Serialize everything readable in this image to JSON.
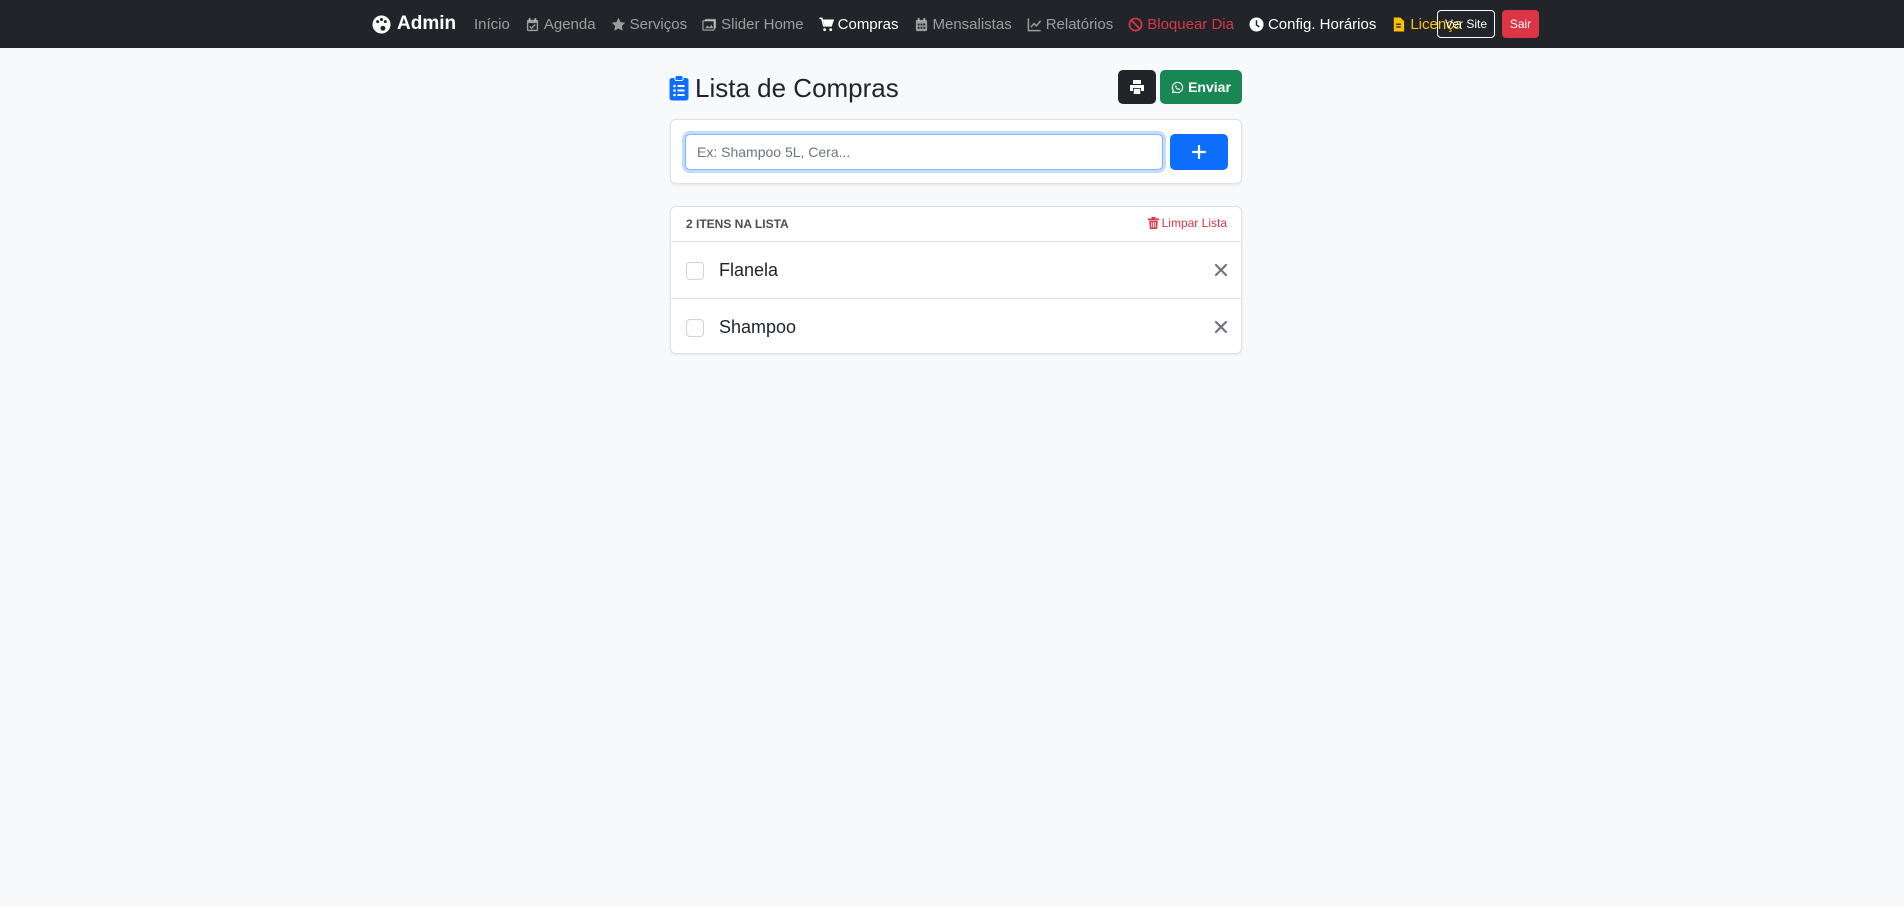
{
  "navbar": {
    "brand": "Admin",
    "items": [
      {
        "label": "Início",
        "icon": "none"
      },
      {
        "label": "Agenda",
        "icon": "calendar-check-icon"
      },
      {
        "label": "Serviços",
        "icon": "star-icon"
      },
      {
        "label": "Slider Home",
        "icon": "images-icon"
      },
      {
        "label": "Compras",
        "icon": "cart-icon"
      },
      {
        "label": "Mensalistas",
        "icon": "calendar-icon"
      },
      {
        "label": "Relatórios",
        "icon": "chart-line-icon"
      },
      {
        "label": "Bloquear Dia",
        "icon": "ban-icon"
      },
      {
        "label": "Config. Horários",
        "icon": "clock-icon"
      },
      {
        "label": "Licença",
        "icon": "file-icon"
      }
    ],
    "ver_site": "Ver Site",
    "sair": "Sair"
  },
  "header": {
    "title": "Lista de Compras",
    "enviar_label": "Enviar"
  },
  "add_form": {
    "placeholder": "Ex: Shampoo 5L, Cera...",
    "value": ""
  },
  "list": {
    "count_label": "2 ITENS NA LISTA",
    "clear_label": "Limpar Lista",
    "items": [
      {
        "label": "Flanela",
        "checked": false
      },
      {
        "label": "Shampoo",
        "checked": false
      }
    ]
  },
  "colors": {
    "navbar_bg": "#212529",
    "primary": "#0d6efd",
    "success": "#198754",
    "danger": "#dc3545",
    "warning": "#ffc107"
  }
}
